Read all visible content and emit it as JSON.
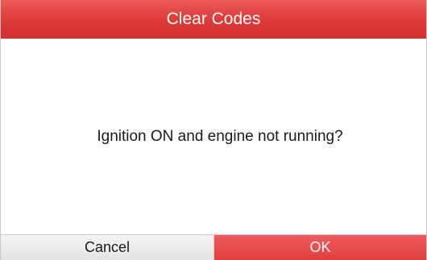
{
  "dialog": {
    "title": "Clear Codes",
    "message": "Ignition ON and engine not running?",
    "buttons": {
      "cancel_label": "Cancel",
      "ok_label": "OK"
    }
  },
  "colors": {
    "title_bar": "#de3838",
    "ok_button": "#e84a4a",
    "cancel_button": "#ececec",
    "title_text": "#ffffff",
    "body_text": "#1a1a1a"
  }
}
